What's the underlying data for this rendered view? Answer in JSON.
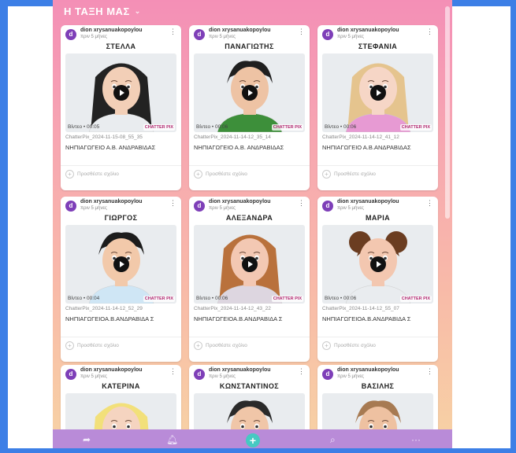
{
  "board": {
    "title": "Η ΤΑΞΗ ΜΑΣ",
    "chevron_icon": "chevron-down-icon"
  },
  "posts": [
    {
      "author": "dion xrysanuakopoylou",
      "time": "πριν 5 μήνες",
      "avatar": "d",
      "title": "ΣΤΕΛΛΑ",
      "duration": "Βίντεο • 00:05",
      "brand": "CHATTER PIX",
      "filename": "ChatterPix_2024-11-15-08_55_35",
      "description": "ΝΗΠΙΑΓΩΓΕΙΟ Α.Β. ΑΝΔΡΑΒΙΔΑΣ",
      "comment": "Προσθέστε σχόλιο",
      "colors": {
        "hair": "#222222",
        "skin": "#f2cfb7",
        "shirt": "#e9ecef"
      }
    },
    {
      "author": "dion xrysanuakopoylou",
      "time": "πριν 5 μήνες",
      "avatar": "d",
      "title": "ΠΑΝΑΓΙΩΤΗΣ",
      "duration": "Βίντεο • 00:06",
      "brand": "CHATTER PIX",
      "filename": "ChatterPix_2024-11-14-12_35_14",
      "description": "ΝΗΠΙΑΓΩΓΕΙΟ Α.Β. ΑΝΔΡΑΒΙΔΑΣ",
      "comment": "Προσθέστε σχόλιο",
      "colors": {
        "hair": "#1f1f1f",
        "skin": "#eec3a4",
        "shirt": "#3d8f3a"
      }
    },
    {
      "author": "dion xrysanuakopoylou",
      "time": "πριν 5 μήνες",
      "avatar": "d",
      "title": "ΣΤΕΦΑΝΙΑ",
      "duration": "Βίντεο • 00:06",
      "brand": "CHATTER PIX",
      "filename": "ChatterPix_2024-11-14-12_41_12",
      "description": "ΝΗΠΙΑΓΩΓΕΙΟ Α.Β.ΑΝΔΡΑΒΙΔΑΣ",
      "comment": "Προσθέστε σχόλιο",
      "colors": {
        "hair": "#e5c48e",
        "skin": "#f6d6c6",
        "shirt": "#e79ad3"
      }
    },
    {
      "author": "dion xrysanuakopoylou",
      "time": "πριν 5 μήνες",
      "avatar": "d",
      "title": "ΓΙΩΡΓΟΣ",
      "duration": "Βίντεο • 00:04",
      "brand": "CHATTER PIX",
      "filename": "ChatterPix_2024-11-14-12_52_29",
      "description": "ΝΗΠΙΑΓΩΓΕΙΟΑ.Β.ΑΝΔΡΑΒΙΔΑ Σ",
      "comment": "Προσθέστε σχόλιο",
      "colors": {
        "hair": "#1c1c1c",
        "skin": "#f2c9aa",
        "shirt": "#cfe6f5"
      }
    },
    {
      "author": "dion xrysanuakopoylou",
      "time": "πριν 5 μήνες",
      "avatar": "d",
      "title": "ΑΛΕΞΑΝΔΡΑ",
      "duration": "Βίντεο • 00:06",
      "brand": "CHATTER PIX",
      "filename": "ChatterPix_2024-11-14-12_43_22",
      "description": "ΝΗΠΙΑΓΩΓΕΙΟΑ.Β.ΑΝΔΡΑΒΙΔΑ Σ",
      "comment": "Προσθέστε σχόλιο",
      "colors": {
        "hair": "#b9713c",
        "skin": "#f3c8b3",
        "shirt": "#ddd6e0"
      }
    },
    {
      "author": "dion xrysanuakopoylou",
      "time": "πριν 5 μήνες",
      "avatar": "d",
      "title": "ΜΑΡΙΑ",
      "duration": "Βίντεο • 00:06",
      "brand": "CHATTER PIX",
      "filename": "ChatterPix_2024-11-14-12_55_07",
      "description": "ΝΗΠΙΑΓΩΓΕΙΟΑ.Β.ΑΝΔΡΑΒΙΔΑ Σ",
      "comment": "Προσθέστε σχόλιο",
      "colors": {
        "hair": "#6b3d21",
        "skin": "#f3c7b0",
        "shirt": "#e9ecef"
      }
    },
    {
      "author": "dion xrysanuakopoylou",
      "time": "πριν 5 μήνες",
      "avatar": "d",
      "title": "ΚΑΤΕΡΙΝΑ",
      "colors": {
        "hair": "#f2e07a",
        "skin": "#f5d4c0",
        "shirt": "#e9ecef"
      }
    },
    {
      "author": "dion xrysanuakopoylou",
      "time": "πριν 5 μήνες",
      "avatar": "d",
      "title": "ΚΩΝΣΤΑΝΤΙΝΟΣ",
      "colors": {
        "hair": "#2a2a2a",
        "skin": "#f0c6a8",
        "shirt": "#e9ecef"
      }
    },
    {
      "author": "dion xrysanuakopoylou",
      "time": "πριν 5 μήνες",
      "avatar": "d",
      "title": "ΒΑΣΙΛΗΣ",
      "colors": {
        "hair": "#a77a52",
        "skin": "#eec1a1",
        "shirt": "#e9ecef"
      }
    }
  ],
  "bottom_nav": {
    "icons": [
      "share-icon",
      "bell-icon",
      "add-icon",
      "search-icon",
      "more-icon"
    ],
    "accent": "#46c9c2"
  }
}
